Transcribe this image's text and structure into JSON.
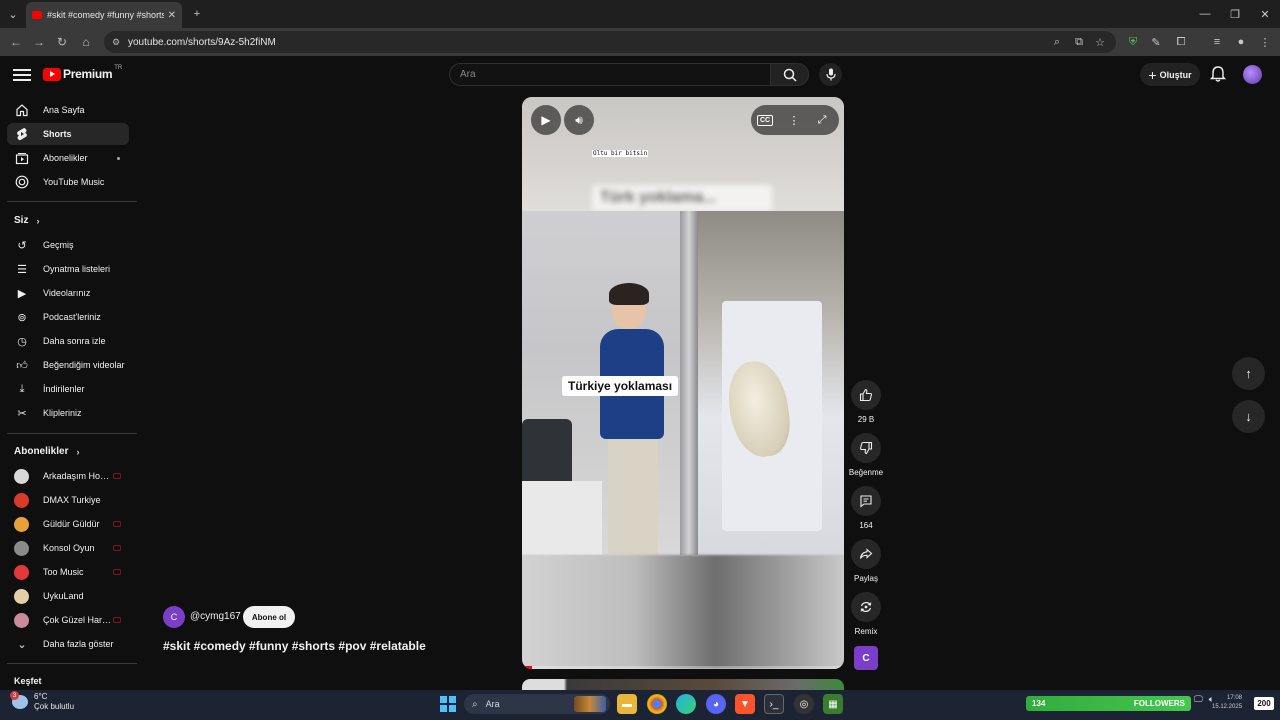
{
  "browser": {
    "tab_title": "#skit #comedy #funny #shorts #...",
    "url": "youtube.com/shorts/9Az-5h2fiNM"
  },
  "header": {
    "logo_text": "Premium",
    "logo_region": "TR",
    "search_placeholder": "Ara",
    "create_label": "Oluştur"
  },
  "sidebar": {
    "main": [
      {
        "label": "Ana Sayfa",
        "icon": "home-icon"
      },
      {
        "label": "Shorts",
        "icon": "shorts-icon"
      },
      {
        "label": "Abonelikler",
        "icon": "subscriptions-icon"
      },
      {
        "label": "YouTube Music",
        "icon": "music-icon"
      }
    ],
    "you_header": "Siz",
    "you": [
      {
        "label": "Geçmiş",
        "icon": "history-icon"
      },
      {
        "label": "Oynatma listeleri",
        "icon": "playlist-icon"
      },
      {
        "label": "Videolarınız",
        "icon": "video-icon"
      },
      {
        "label": "Podcast'leriniz",
        "icon": "podcast-icon"
      },
      {
        "label": "Daha sonra izle",
        "icon": "clock-icon"
      },
      {
        "label": "Beğendiğim videolar",
        "icon": "like-icon"
      },
      {
        "label": "İndirilenler",
        "icon": "download-icon"
      },
      {
        "label": "Klipleriniz",
        "icon": "scissors-icon"
      }
    ],
    "subs_header": "Abonelikler",
    "subs": [
      {
        "label": "Arkadaşım Hoşg...",
        "color": "#d9d9d9"
      },
      {
        "label": "DMAX Turkiye",
        "color": "#d93a2a"
      },
      {
        "label": "Güldür Güldür",
        "color": "#e8a13a"
      },
      {
        "label": "Konsol Oyun",
        "color": "#8a8a8a"
      },
      {
        "label": "Too Music",
        "color": "#e23a3a"
      },
      {
        "label": "UykuLand",
        "color": "#e2cfa8"
      },
      {
        "label": "Çok Güzel Harek...",
        "color": "#c98a9a"
      }
    ],
    "show_more": "Daha fazla göster",
    "explore_header": "Keşfet"
  },
  "short": {
    "caption": "Türkiye yoklaması",
    "small_subtitle": "Oltu bir bitsin",
    "blurred_text": "Türk  yoklama...",
    "progress": 0.03,
    "channel_initial": "C",
    "channel": "@cymg167",
    "subscribe": "Abone ol",
    "description": "#skit #comedy #funny #shorts #pov #relatable",
    "cc_label": "CC"
  },
  "actions": {
    "likes": "29 B",
    "dislike": "Beğenme",
    "comments": "164",
    "share": "Paylaş",
    "remix": "Remix"
  },
  "taskbar": {
    "temp": "6°C",
    "weather": "Çok bulutlu",
    "weather_badge": "3",
    "search": "Ara",
    "followers_count": "134",
    "followers_label": "FOLLOWERS",
    "notif_count": "200",
    "time": "17:08",
    "date": "15.12.2025"
  }
}
